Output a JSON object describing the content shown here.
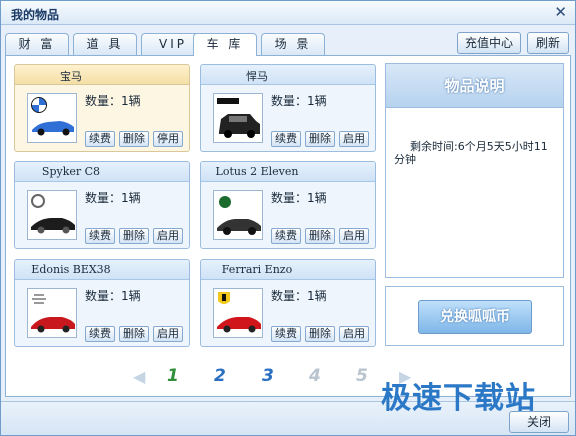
{
  "window": {
    "title": "我的物品"
  },
  "tabs": [
    {
      "label": "财 富"
    },
    {
      "label": "道 具"
    },
    {
      "label": "VIP"
    },
    {
      "label": "车 库",
      "active": true
    },
    {
      "label": "场 景"
    }
  ],
  "toolbar": {
    "recharge_label": "充值中心",
    "refresh_label": "刷新"
  },
  "cars": [
    {
      "name": "宝马",
      "quantity": "数量：1辆",
      "buttons": [
        "续费",
        "删除",
        "停用"
      ],
      "selected": true,
      "logo": "bmw-icon",
      "color": "#2f6fd6"
    },
    {
      "name": "悍马",
      "quantity": "数量：1辆",
      "buttons": [
        "续费",
        "删除",
        "启用"
      ],
      "logo": "hummer-icon",
      "color": "#222222"
    },
    {
      "name": "Spyker C8",
      "quantity": "数量：1辆",
      "buttons": [
        "续费",
        "删除",
        "启用"
      ],
      "logo": "spyker-icon",
      "color": "#1c1c1c"
    },
    {
      "name": "Lotus 2 Eleven",
      "quantity": "数量：1辆",
      "buttons": [
        "续费",
        "删除",
        "启用"
      ],
      "logo": "lotus-icon",
      "color": "#333333"
    },
    {
      "name": "Edonis BEX38",
      "quantity": "数量：1辆",
      "buttons": [
        "续费",
        "删除",
        "启用"
      ],
      "logo": "edonis-icon",
      "color": "#c8181e"
    },
    {
      "name": "Ferrari Enzo",
      "quantity": "数量：1辆",
      "buttons": [
        "续费",
        "删除",
        "启用"
      ],
      "logo": "ferrari-icon",
      "color": "#d0161b"
    }
  ],
  "info": {
    "title": "物品说明",
    "text": "剩余时间:6个月5天5小时11分钟"
  },
  "exchange": {
    "label": "兑换呱呱币"
  },
  "pager": {
    "pages": [
      "1",
      "2",
      "3",
      "4",
      "5"
    ],
    "current": "1"
  },
  "watermark": "极速下载站",
  "footer": {
    "close_label": "关闭"
  },
  "colors": {
    "accent": "#2b78c7",
    "current_page": "#2f8f3a",
    "page": "#2a6fc0",
    "page_disabled": "#b9c4cf"
  }
}
